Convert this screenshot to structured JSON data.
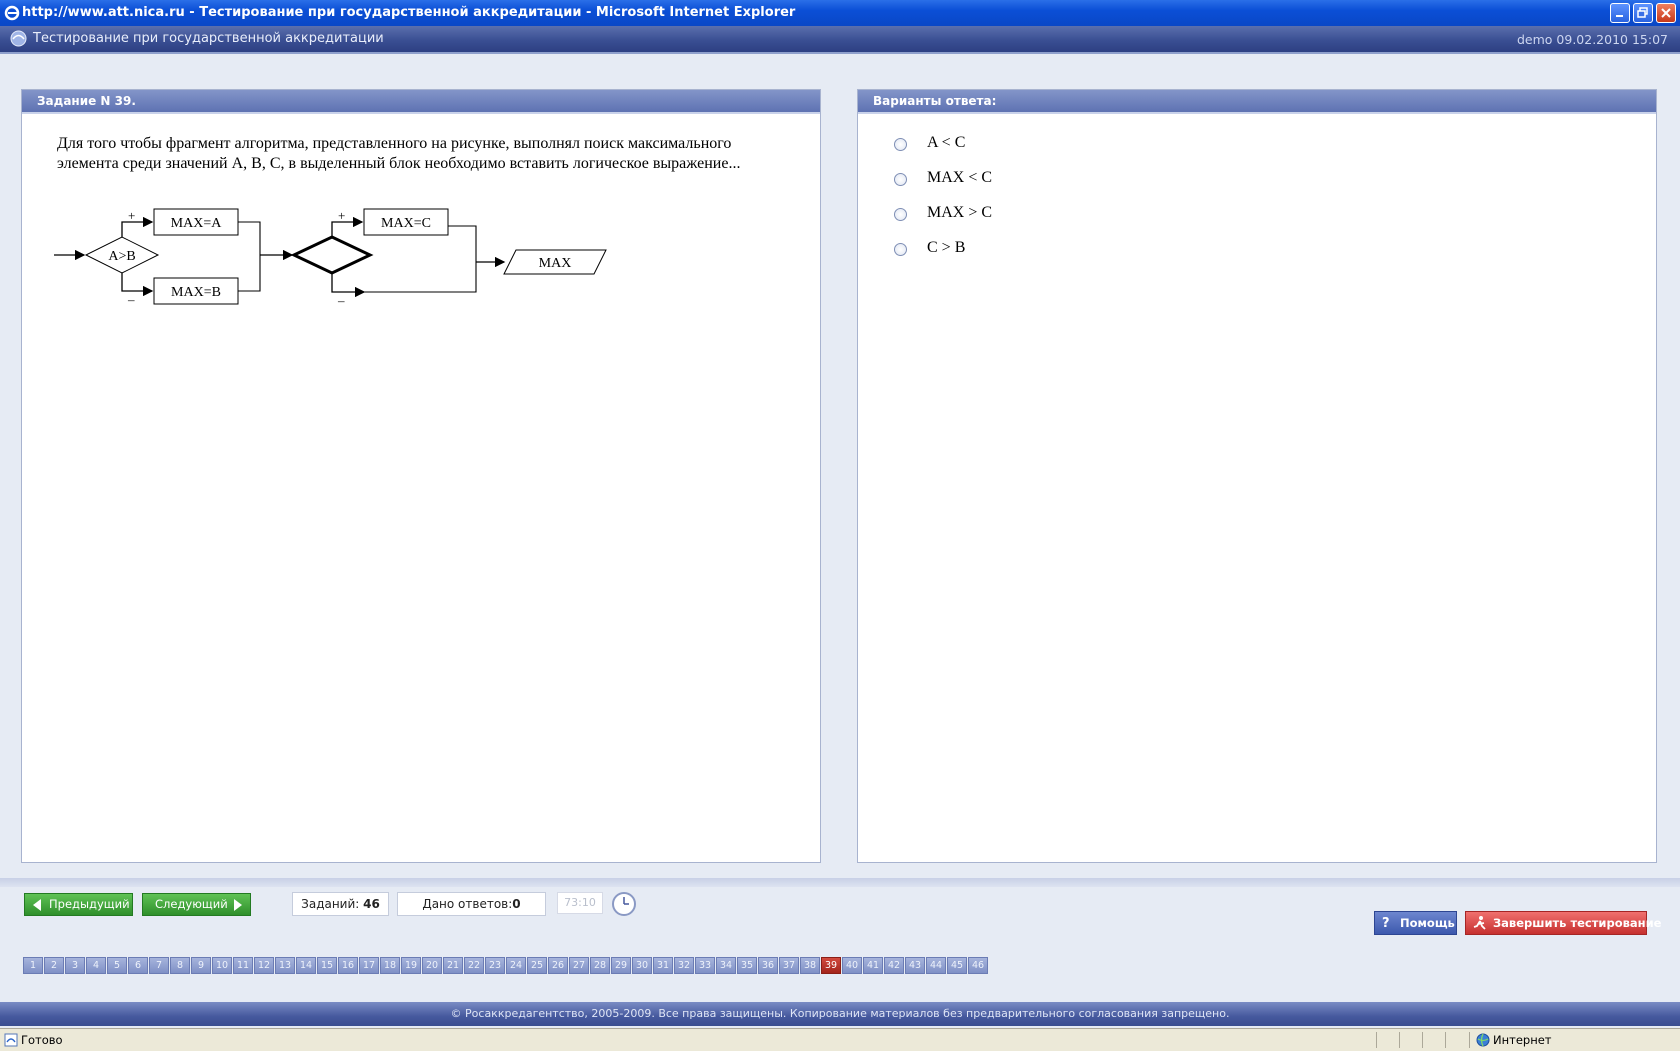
{
  "window": {
    "title": "http://www.att.nica.ru - Тестирование при государственной аккредитации - Microsoft Internet Explorer"
  },
  "app": {
    "title": "Тестирование при государственной аккредитации",
    "user_info": "demo 09.02.2010 15:07"
  },
  "question_panel": {
    "header": "Задание N 39.",
    "text": "Для того чтобы фрагмент алгоритма, представленного на рисунке, выполнял поиск максимального элемента среди значений A, B, C, в выделенный блок необходимо вставить логическое выражение...",
    "flowchart": {
      "condition": "A>B",
      "assign_a": "MAX=A",
      "assign_b": "MAX=B",
      "assign_c": "MAX=C",
      "output": "MAX",
      "plus": "+",
      "minus": "–"
    }
  },
  "answers_panel": {
    "header": "Варианты ответа:",
    "options": [
      "A < C",
      "MAX < C",
      "MAX > C",
      "C > B"
    ]
  },
  "navigation": {
    "prev_label": "Предыдущий",
    "next_label": "Следующий",
    "tasks_label": "Заданий:",
    "tasks_count": "46",
    "answered_label": "Дано ответов:",
    "answered_count": "0",
    "timer": "73:10",
    "help_label": "Помощь",
    "finish_label": "Завершить тестирование"
  },
  "pages": {
    "current": 39,
    "items": [
      "1",
      "2",
      "3",
      "4",
      "5",
      "6",
      "7",
      "8",
      "9",
      "10",
      "11",
      "12",
      "13",
      "14",
      "15",
      "16",
      "17",
      "18",
      "19",
      "20",
      "21",
      "22",
      "23",
      "24",
      "25",
      "26",
      "27",
      "28",
      "29",
      "30",
      "31",
      "32",
      "33",
      "34",
      "35",
      "36",
      "37",
      "38",
      "39",
      "40",
      "41",
      "42",
      "43",
      "44",
      "45",
      "46"
    ]
  },
  "footer": {
    "copyright": "© Росаккредагентство, 2005-2009. Все права защищены. Копирование материалов без предварительного согласования запрещено."
  },
  "statusbar": {
    "status": "Готово",
    "zone": "Интернет"
  },
  "colors": {
    "title_bar": "#0b4fd6",
    "app_header": "#3a4f93",
    "nav_button": "#2f8f2b",
    "current_page": "#a3241b",
    "finish_button": "#c6302f",
    "help_button": "#3c58ad"
  }
}
